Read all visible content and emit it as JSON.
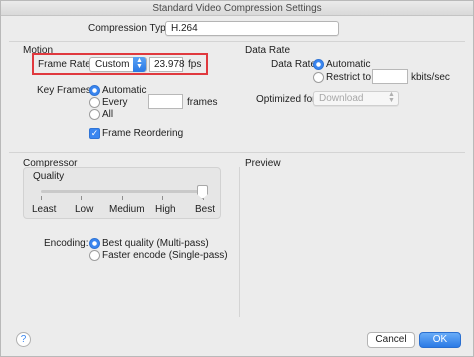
{
  "window": {
    "title": "Standard Video Compression Settings"
  },
  "compression": {
    "label": "Compression Type:",
    "value": "H.264"
  },
  "motion": {
    "section_title": "Motion",
    "frame_rate_label": "Frame Rate:",
    "frame_rate_select": "Custom",
    "frame_rate_value": "23.978",
    "frame_rate_unit": "fps",
    "key_frames_label": "Key Frames:",
    "key_frames_options": [
      "Automatic",
      "Every",
      "All"
    ],
    "key_frames_selected": "Automatic",
    "key_frames_every_value": "",
    "key_frames_unit": "frames",
    "frame_reordering_label": "Frame Reordering",
    "frame_reordering_checked": true
  },
  "data_rate": {
    "section_title": "Data Rate",
    "label": "Data Rate:",
    "options": [
      "Automatic",
      "Restrict to"
    ],
    "selected": "Automatic",
    "restrict_value": "",
    "unit": "kbits/sec",
    "optimized_label": "Optimized for:",
    "optimized_value": "Download"
  },
  "compressor": {
    "section_title": "Compressor",
    "quality_label": "Quality",
    "quality_ticks": [
      "Least",
      "Low",
      "Medium",
      "High",
      "Best"
    ],
    "quality_level": "Best",
    "encoding_label": "Encoding:",
    "encoding_options": [
      "Best quality (Multi-pass)",
      "Faster encode (Single-pass)"
    ],
    "encoding_selected": "Best quality (Multi-pass)"
  },
  "preview": {
    "section_title": "Preview"
  },
  "buttons": {
    "help": "?",
    "cancel": "Cancel",
    "ok": "OK"
  },
  "colors": {
    "accent": "#3a86f0",
    "highlight": "#e0393e",
    "window_bg": "#ececec"
  }
}
